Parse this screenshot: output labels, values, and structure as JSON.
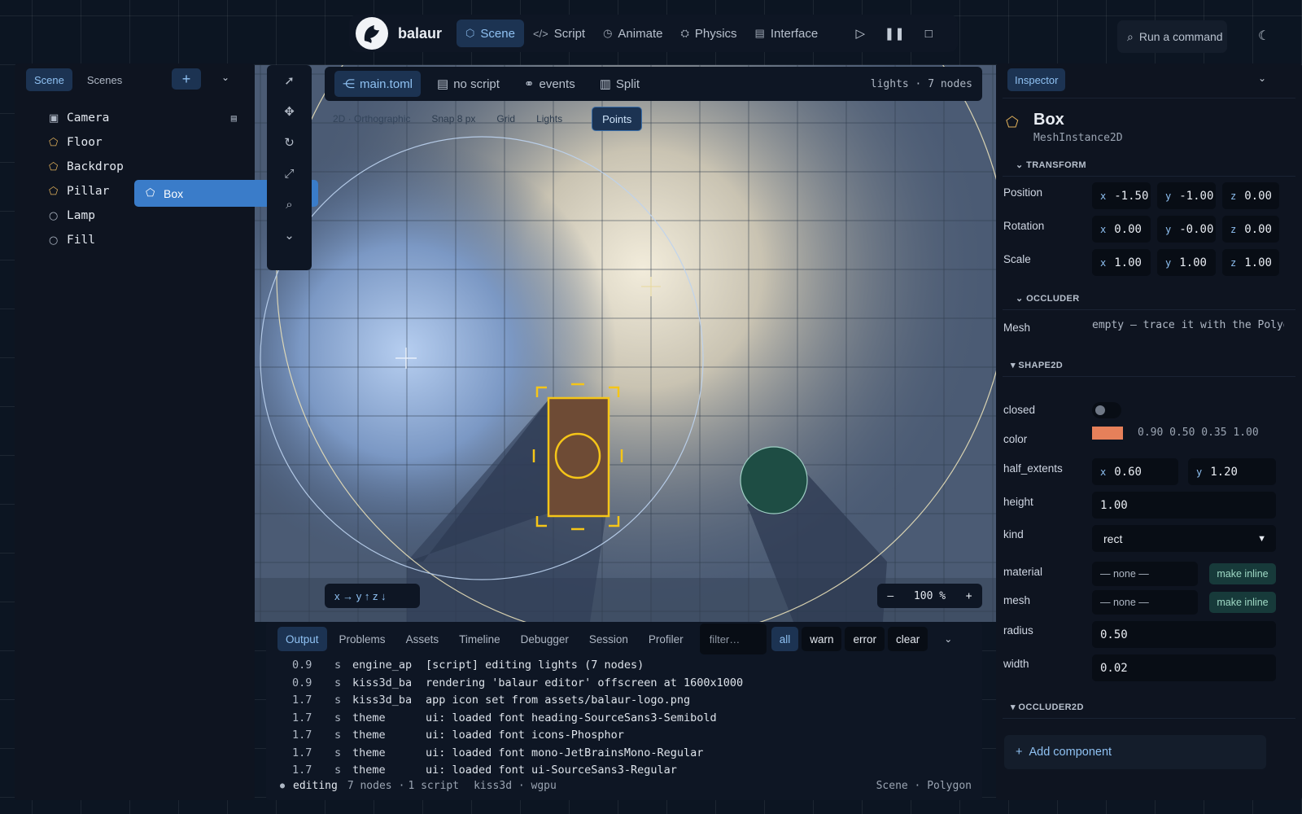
{
  "app": {
    "name": "balaur"
  },
  "topbar": {
    "tabs": [
      {
        "label": "Scene",
        "icon": "cube-icon"
      },
      {
        "label": "Script",
        "icon": "code-icon"
      },
      {
        "label": "Animate",
        "icon": "clock-icon"
      },
      {
        "label": "Physics",
        "icon": "joint-icon"
      },
      {
        "label": "Interface",
        "icon": "layout-icon"
      }
    ],
    "active_tab": "Scene",
    "controls": [
      "play-icon",
      "pause-icon",
      "stop-icon"
    ],
    "command_placeholder": "Run a command",
    "theme_icon": "moon-icon"
  },
  "scene_panel": {
    "tabs": [
      "Scene",
      "Scenes"
    ],
    "active_tab": "Scene",
    "tree": [
      {
        "label": "Camera",
        "icon": "camera-icon",
        "extra_icon": "script-file-icon"
      },
      {
        "label": "Floor",
        "icon": "mesh-icon"
      },
      {
        "label": "Backdrop",
        "icon": "mesh-icon"
      },
      {
        "label": "Box",
        "icon": "mesh-icon",
        "selected": true
      },
      {
        "label": "Pillar",
        "icon": "mesh-icon"
      },
      {
        "label": "Lamp",
        "icon": "light-icon"
      },
      {
        "label": "Fill",
        "icon": "light-icon"
      }
    ]
  },
  "tool_rail": [
    "select-icon",
    "move-icon",
    "rotate-icon",
    "scale-icon",
    "zoom-icon",
    "more-icon"
  ],
  "viewport": {
    "tabs": [
      {
        "label": "main.toml",
        "icon": "graph-icon"
      },
      {
        "label": "no script",
        "icon": "file-icon"
      },
      {
        "label": "events",
        "icon": "link-icon"
      },
      {
        "label": "Split",
        "icon": "split-icon"
      }
    ],
    "info": "lights · 7 nodes",
    "options": [
      "2D · Orthographic",
      "Snap 8 px",
      "Grid",
      "Lights"
    ],
    "points_button": "Points",
    "axes_label": "x → y ↑ z ↓",
    "zoom": {
      "minus": "–",
      "value": "100 %",
      "plus": "+"
    }
  },
  "output": {
    "tabs": [
      "Output",
      "Problems",
      "Assets",
      "Timeline",
      "Debugger",
      "Session",
      "Profiler"
    ],
    "active_tab": "Output",
    "filter_placeholder": "filter…",
    "levels": [
      "all",
      "warn",
      "error",
      "clear"
    ],
    "logs": [
      {
        "time": "0.9",
        "unit": "s",
        "source": "engine_ap",
        "msg": "[script] editing lights (7 nodes)"
      },
      {
        "time": "0.9",
        "unit": "s",
        "source": "kiss3d_ba",
        "msg": "rendering 'balaur editor' offscreen at 1600x1000"
      },
      {
        "time": "1.7",
        "unit": "s",
        "source": "kiss3d_ba",
        "msg": "app icon set from assets/balaur-logo.png"
      },
      {
        "time": "1.7",
        "unit": "s",
        "source": "theme",
        "msg": "ui: loaded font heading-SourceSans3-Semibold"
      },
      {
        "time": "1.7",
        "unit": "s",
        "source": "theme",
        "msg": "ui: loaded font icons-Phosphor"
      },
      {
        "time": "1.7",
        "unit": "s",
        "source": "theme",
        "msg": "ui: loaded font mono-JetBrainsMono-Regular"
      },
      {
        "time": "1.7",
        "unit": "s",
        "source": "theme",
        "msg": "ui: loaded font ui-SourceSans3-Regular"
      }
    ],
    "status": {
      "dot": "●",
      "state": "editing",
      "nodes": "7 nodes",
      "script": "1 script",
      "backend": "kiss3d · wgpu",
      "right": "Scene · Polygon"
    }
  },
  "inspector": {
    "tab": "Inspector",
    "node_name": "Box",
    "node_type": "MeshInstance2D",
    "sections": {
      "transform": "TRANSFORM",
      "occluder": "OCCLUDER",
      "shape2d": "SHAPE2D",
      "occluder2d": "OCCLUDER2D"
    },
    "position": {
      "label": "Position",
      "x": "-1.50",
      "y": "-1.00",
      "z": "0.00"
    },
    "rotation": {
      "label": "Rotation",
      "x": "0.00",
      "y": "-0.00",
      "z": "0.00"
    },
    "scale": {
      "label": "Scale",
      "x": "1.00",
      "y": "1.00",
      "z": "1.00"
    },
    "mesh": {
      "label": "Mesh",
      "value": "empty — trace it with the Polygon tool"
    },
    "closed": {
      "label": "closed",
      "on": false
    },
    "color": {
      "label": "color",
      "value": "0.90 0.50 0.35 1.00",
      "swatch": "#e6805a"
    },
    "half_extents": {
      "label": "half_extents",
      "x": "0.60",
      "y": "1.20"
    },
    "height": {
      "label": "height",
      "value": "1.00"
    },
    "kind": {
      "label": "kind",
      "value": "rect"
    },
    "material": {
      "label": "material",
      "value": "— none —",
      "button": "make inline"
    },
    "mesh2": {
      "label": "mesh",
      "value": "— none —",
      "button": "make inline"
    },
    "radius": {
      "label": "radius",
      "value": "0.50"
    },
    "width": {
      "label": "width",
      "value": "0.02"
    },
    "add_component": "Add component"
  },
  "colors": {
    "accent": "#3a7cc9",
    "selection": "#f5c518",
    "panel": "#0e1624",
    "tab_active": "#1c3352"
  }
}
